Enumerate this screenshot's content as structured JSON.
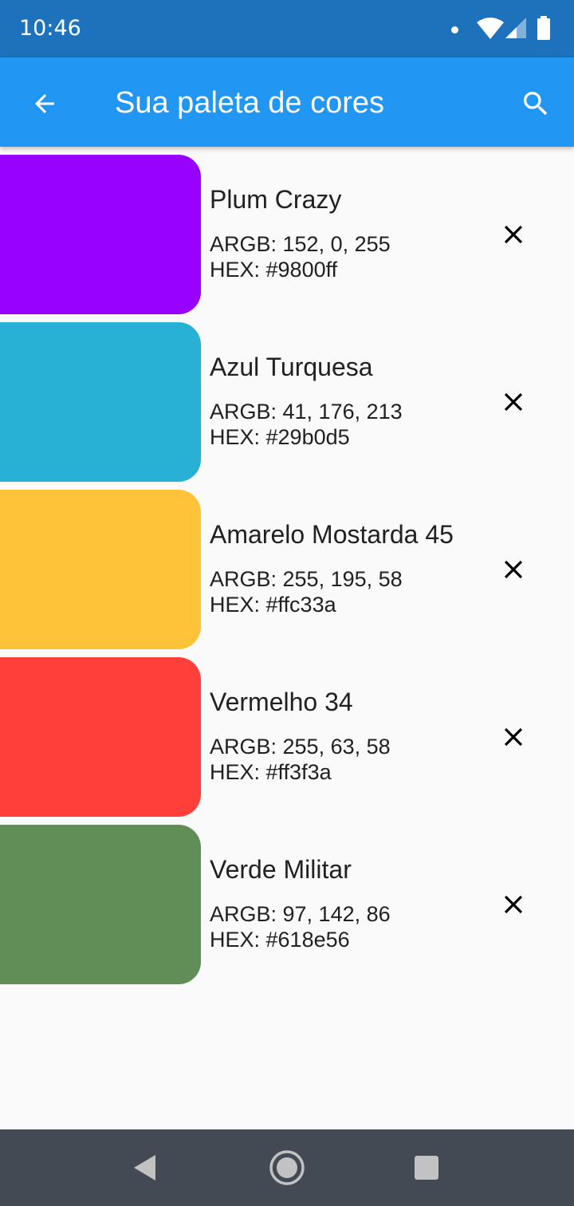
{
  "status_bar": {
    "time": "10:46",
    "background": "#1e72bc",
    "icons": [
      "notification-dot-icon",
      "wifi-icon",
      "cell-signal-icon",
      "battery-icon"
    ]
  },
  "app_bar": {
    "title": "Sua paleta de cores",
    "background": "#2196f3",
    "back_icon": "arrow-back-icon",
    "search_icon": "search-icon"
  },
  "colors": [
    {
      "name": "Plum Crazy",
      "argb": "ARGB: 152, 0, 255",
      "hex": "HEX: #9800ff",
      "swatch": "#9800ff"
    },
    {
      "name": "Azul Turquesa",
      "argb": "ARGB: 41, 176, 213",
      "hex": "HEX: #29b0d5",
      "swatch": "#29b0d5"
    },
    {
      "name": "Amarelo Mostarda 45",
      "argb": "ARGB: 255, 195, 58",
      "hex": "HEX: #ffc33a",
      "swatch": "#ffc33a"
    },
    {
      "name": "Vermelho 34",
      "argb": "ARGB: 255, 63, 58",
      "hex": "HEX: #ff3f3a",
      "swatch": "#ff3f3a"
    },
    {
      "name": "Verde Militar",
      "argb": "ARGB: 97, 142, 86",
      "hex": "HEX: #618e56",
      "swatch": "#618e56"
    }
  ],
  "remove_icon": "close-icon",
  "nav_bar": {
    "background": "#434a53",
    "icons": [
      "nav-back-icon",
      "nav-home-icon",
      "nav-recents-icon"
    ]
  }
}
